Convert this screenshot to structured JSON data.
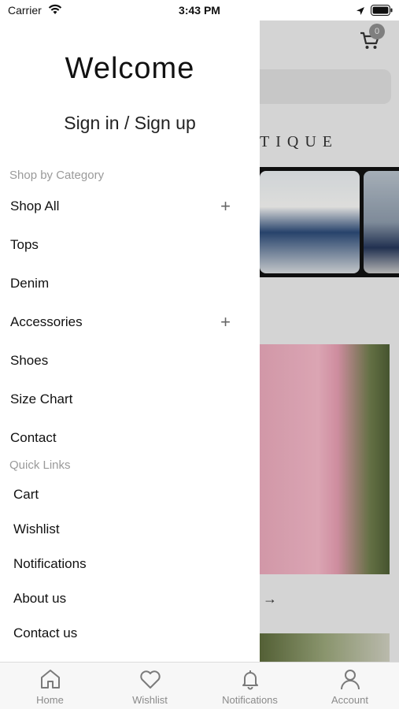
{
  "status": {
    "carrier": "Carrier",
    "time": "3:43 PM"
  },
  "background_app": {
    "cart_count": "0",
    "banner_text": "TIQUE"
  },
  "drawer": {
    "welcome": "Welcome",
    "signin": "Sign in / Sign up",
    "category_heading": "Shop by Category",
    "categories": [
      {
        "label": "Shop All",
        "expandable": true
      },
      {
        "label": "Tops",
        "expandable": false
      },
      {
        "label": "Denim",
        "expandable": false
      },
      {
        "label": "Accessories",
        "expandable": true
      },
      {
        "label": "Shoes",
        "expandable": false
      },
      {
        "label": "Size Chart",
        "expandable": false
      },
      {
        "label": "Contact",
        "expandable": false
      }
    ],
    "quick_links_heading": "Quick Links",
    "quick_links": [
      "Cart",
      "Wishlist",
      "Notifications",
      "About us",
      "Contact us"
    ]
  },
  "tabs": [
    {
      "label": "Home",
      "icon": "home-icon"
    },
    {
      "label": "Wishlist",
      "icon": "heart-icon"
    },
    {
      "label": "Notifications",
      "icon": "bell-icon"
    },
    {
      "label": "Account",
      "icon": "person-icon"
    }
  ]
}
